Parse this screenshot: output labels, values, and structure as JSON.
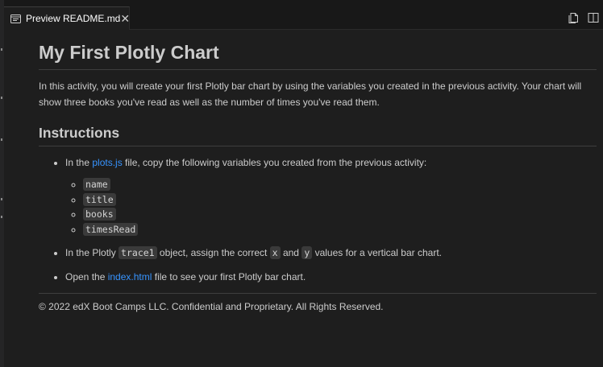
{
  "tab": {
    "title": "Preview README.md",
    "close_glyph": "✕",
    "icon": "preview-icon"
  },
  "toolbar": {
    "icons": [
      "open-source-icon",
      "split-editor-icon"
    ]
  },
  "doc": {
    "title": "My First Plotly Chart",
    "intro": "In this activity, you will create your first Plotly bar chart by using the variables you created in the previous activity. Your chart will show three books you've read as well as the number of times you've read them.",
    "instructions_heading": "Instructions",
    "step1": {
      "prefix": "In the ",
      "link": "plots.js",
      "suffix": " file, copy the following variables you created from the previous activity:"
    },
    "variables": [
      "name",
      "title",
      "books",
      "timesRead"
    ],
    "step2": {
      "prefix": "In the Plotly ",
      "code1": "trace1",
      "middle1": " object, assign the correct ",
      "code2": "x",
      "middle2": " and ",
      "code3": "y",
      "suffix": " values for a vertical bar chart."
    },
    "step3": {
      "prefix": "Open the ",
      "link": "index.html",
      "suffix": " file to see your first Plotly bar chart."
    },
    "footer": "© 2022 edX Boot Camps LLC. Confidential and Proprietary. All Rights Reserved."
  },
  "colors": {
    "background": "#1e1e1e",
    "text": "#cccccc",
    "link": "#3794ff",
    "code_bg": "#3a3a3a"
  }
}
